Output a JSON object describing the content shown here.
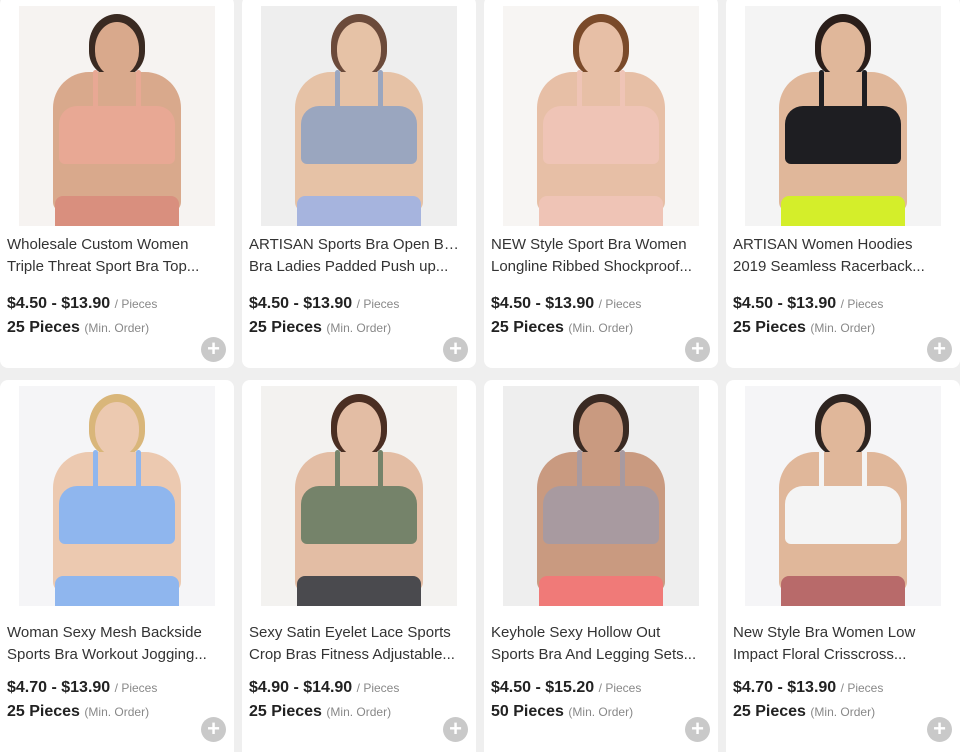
{
  "products": [
    {
      "title_line1": "Wholesale Custom Women",
      "title_line2": "Triple Threat Sport Bra Top...",
      "price": "$4.50 - $13.90",
      "unit": "/ Pieces",
      "moq": "25 Pieces",
      "moq_note": "(Min. Order)",
      "colors": {
        "bg": "#f6f3f1",
        "skin": "#d9a98c",
        "hair": "#3a2a22",
        "top": "#e8a894",
        "bottom": "#d98f7e"
      }
    },
    {
      "title_line1": "ARTISAN Sports Bra Open Back",
      "title_line2": "Bra Ladies Padded Push up...",
      "price": "$4.50 - $13.90",
      "unit": "/ Pieces",
      "moq": "25 Pieces",
      "moq_note": "(Min. Order)",
      "colors": {
        "bg": "#eeeeee",
        "skin": "#e6c2a6",
        "hair": "#6b4a3a",
        "top": "#9aa6bf",
        "bottom": "#a6b4de"
      }
    },
    {
      "title_line1": "NEW Style Sport Bra Women",
      "title_line2": "Longline Ribbed Shockproof...",
      "price": "$4.50 - $13.90",
      "unit": "/ Pieces",
      "moq": "25 Pieces",
      "moq_note": "(Min. Order)",
      "colors": {
        "bg": "#f7f5f3",
        "skin": "#e7bfa6",
        "hair": "#7a4a2a",
        "top": "#efc4b6",
        "bottom": "#efc4b6"
      }
    },
    {
      "title_line1": "ARTISAN Women Hoodies",
      "title_line2": "2019 Seamless Racerback...",
      "price": "$4.50 - $13.90",
      "unit": "/ Pieces",
      "moq": "25 Pieces",
      "moq_note": "(Min. Order)",
      "colors": {
        "bg": "#f4f4f4",
        "skin": "#e0b79a",
        "hair": "#2a1e1a",
        "top": "#1e1e22",
        "bottom": "#d4ee2a"
      }
    },
    {
      "title_line1": "Woman Sexy Mesh Backside",
      "title_line2": "Sports Bra Workout Jogging...",
      "price": "$4.70 - $13.90",
      "unit": "/ Pieces",
      "moq": "25 Pieces",
      "moq_note": "(Min. Order)",
      "colors": {
        "bg": "#f5f5f7",
        "skin": "#ecc9b0",
        "hair": "#d9b67a",
        "top": "#8fb6ee",
        "bottom": "#8fb6ee"
      }
    },
    {
      "title_line1": "Sexy Satin Eyelet Lace Sports",
      "title_line2": "Crop Bras Fitness Adjustable...",
      "price": "$4.90 - $14.90",
      "unit": "/ Pieces",
      "moq": "25 Pieces",
      "moq_note": "(Min. Order)",
      "colors": {
        "bg": "#f3f2f0",
        "skin": "#e3bda4",
        "hair": "#4a2e22",
        "top": "#75836a",
        "bottom": "#4a4a4e"
      }
    },
    {
      "title_line1": "Keyhole Sexy Hollow Out",
      "title_line2": "Sports Bra And Legging Sets...",
      "price": "$4.50 - $15.20",
      "unit": "/ Pieces",
      "moq": "50 Pieces",
      "moq_note": "(Min. Order)",
      "colors": {
        "bg": "#eeeeee",
        "skin": "#c99a80",
        "hair": "#3a2a22",
        "top": "#a89aa0",
        "bottom": "#f07a78"
      }
    },
    {
      "title_line1": "New Style Bra Women Low",
      "title_line2": "Impact Floral Crisscross...",
      "price": "$4.70 - $13.90",
      "unit": "/ Pieces",
      "moq": "25 Pieces",
      "moq_note": "(Min. Order)",
      "colors": {
        "bg": "#f5f5f7",
        "skin": "#e0b79a",
        "hair": "#2e2420",
        "top": "#f4f4f4",
        "bottom": "#b86a6a"
      }
    }
  ]
}
